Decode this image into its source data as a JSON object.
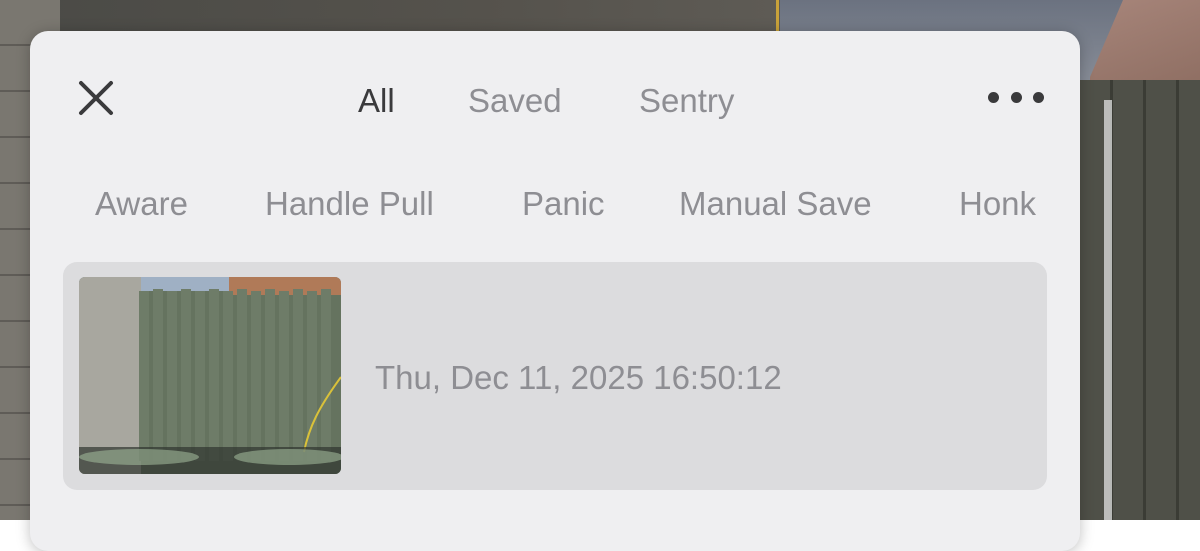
{
  "header": {
    "close_icon": "close-icon",
    "more_icon": "more-horizontal-icon",
    "tabs": [
      {
        "label": "All",
        "active": true
      },
      {
        "label": "Saved",
        "active": false
      },
      {
        "label": "Sentry",
        "active": false
      }
    ]
  },
  "filters": [
    {
      "label": "Aware"
    },
    {
      "label": "Handle Pull"
    },
    {
      "label": "Panic"
    },
    {
      "label": "Manual Save"
    },
    {
      "label": "Honk"
    }
  ],
  "clips": [
    {
      "timestamp": "Thu, Dec 11, 2025 16:50:12",
      "thumbnail_icon": "clip-thumbnail"
    }
  ],
  "colors": {
    "panel_bg": "#efeff1",
    "card_bg": "#dcdcde",
    "text_active": "#3a3a3c",
    "text_muted": "#8e8e93"
  }
}
